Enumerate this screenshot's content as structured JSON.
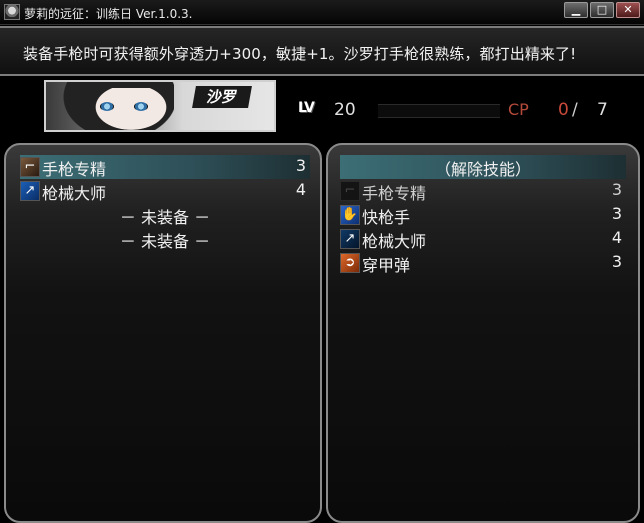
{
  "window": {
    "title": "萝莉的远征：训练日 Ver.1.0.3.",
    "buttons": {
      "minimize": "▁",
      "maximize": "□",
      "close": "✕"
    }
  },
  "message": "装备手枪时可获得额外穿透力+300，敏捷+1。沙罗打手枪很熟练，都打出精来了!",
  "character": {
    "name": "沙罗",
    "level_label": "LV",
    "level": "20",
    "exp_progress": 0.0,
    "cp_label": "CP",
    "cp_used": "0",
    "cp_slash": "/",
    "cp_total": "7"
  },
  "equipped": {
    "items": [
      {
        "icon": "pistol-icon",
        "glyph": "⌐",
        "label": "手枪专精",
        "value": "3",
        "selected": true
      },
      {
        "icon": "gun-icon",
        "glyph": "↗",
        "label": "枪械大师",
        "value": "4",
        "selected": false
      },
      {
        "label": "－ 未装备 －",
        "empty": true
      },
      {
        "label": "－ 未装备 －",
        "empty": true
      }
    ]
  },
  "available": {
    "header": "（解除技能）",
    "items": [
      {
        "icon": "pistol-icon",
        "glyph": "⌐",
        "label": "手枪专精",
        "value": "3",
        "dim": true
      },
      {
        "icon": "quick-hand-icon",
        "glyph": "✋",
        "label": "快枪手",
        "value": "3"
      },
      {
        "icon": "gun-icon",
        "glyph": "↗",
        "label": "枪械大师",
        "value": "4"
      },
      {
        "icon": "pierce-icon",
        "glyph": "➲",
        "label": "穿甲弹",
        "value": "3"
      }
    ]
  },
  "colors": {
    "highlight": "#3c6e76",
    "cp_label": "#b34a3a",
    "panel_border": "#8a8a8a"
  }
}
